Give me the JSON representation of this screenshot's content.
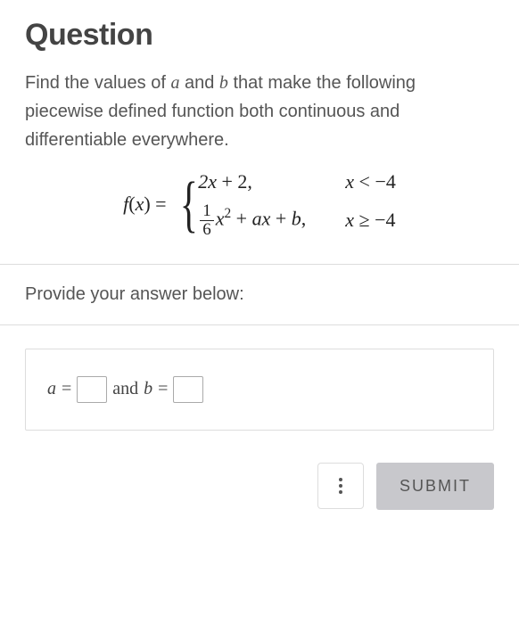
{
  "heading": "Question",
  "prompt": {
    "part1": "Find the values of ",
    "varA": "a",
    "part2": " and ",
    "varB": "b",
    "part3": " that make the following piecewise defined function both continuous and differentiable everywhere."
  },
  "equation": {
    "lhs_f": "f",
    "lhs_x": "x",
    "case1_expr": "2x + 2,",
    "case1_cond_var": "x",
    "case1_cond_rest": " < −4",
    "frac_num": "1",
    "frac_den": "6",
    "case2_var_x": "x",
    "case2_sup": "2",
    "case2_mid1": " + ",
    "case2_var_a": "a",
    "case2_var_x2": "x",
    "case2_mid2": " + ",
    "case2_var_b": "b",
    "case2_comma": ",",
    "case2_cond_var": "x",
    "case2_cond_rest": " ≥ −4"
  },
  "instruction": "Provide your answer below:",
  "answer": {
    "a_label": "a",
    "eq": " = ",
    "and": " and ",
    "b_label": "b"
  },
  "buttons": {
    "submit": "SUBMIT"
  }
}
